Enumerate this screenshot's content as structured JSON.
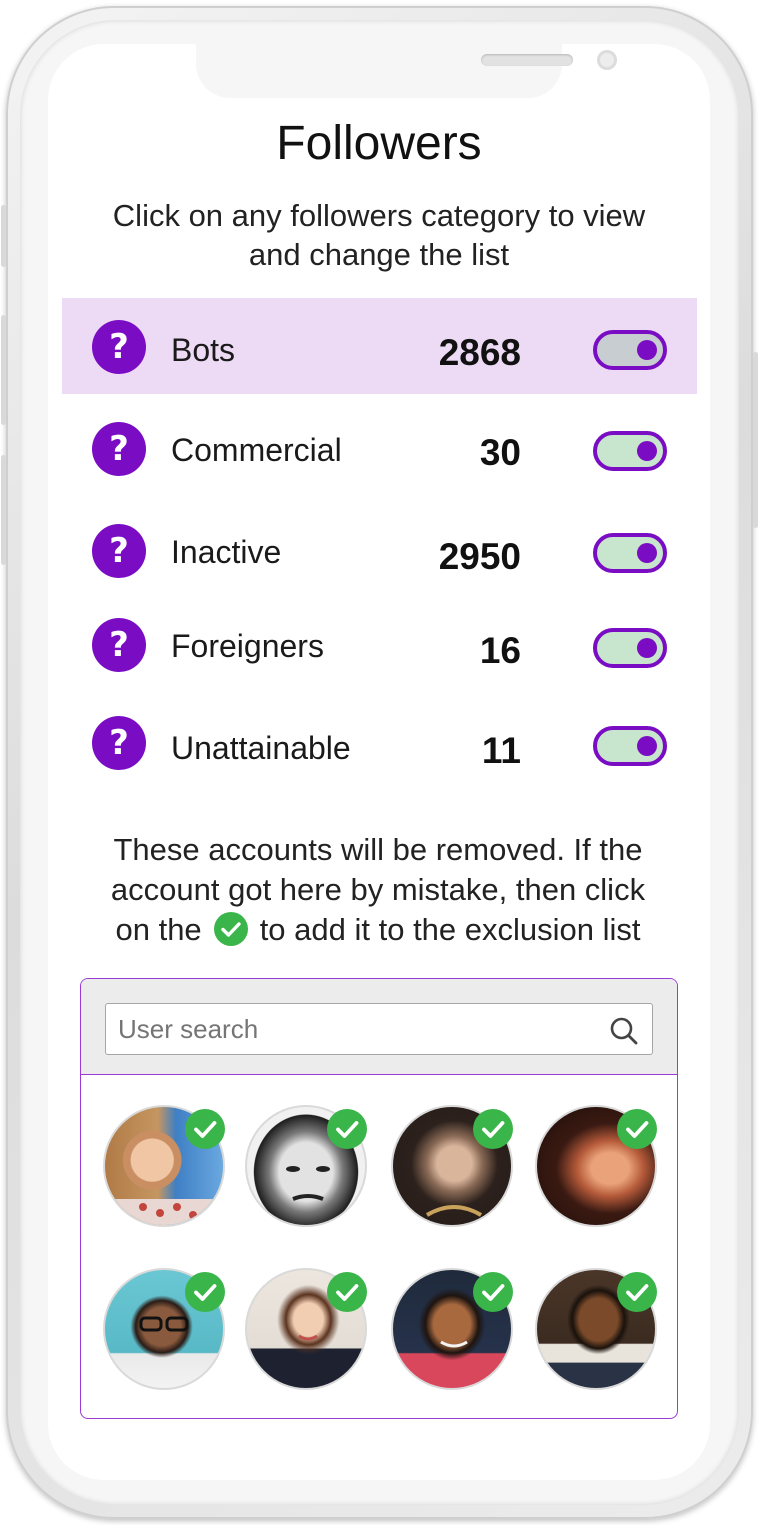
{
  "page": {
    "title": "Followers",
    "subtitle": "Click on any followers category to view and change the list"
  },
  "categories": [
    {
      "label": "Bots",
      "count": "2868",
      "selected": true,
      "toggle_on": true
    },
    {
      "label": "Commercial",
      "count": "30",
      "selected": false,
      "toggle_on": true
    },
    {
      "label": "Inactive",
      "count": "2950",
      "selected": false,
      "toggle_on": true
    },
    {
      "label": "Foreigners",
      "count": "16",
      "selected": false,
      "toggle_on": true
    },
    {
      "label": "Unattainable",
      "count": "11",
      "selected": false,
      "toggle_on": true
    }
  ],
  "notice": {
    "line1": "These accounts will be removed. If the",
    "line2": "account got here by mistake, then click",
    "line3_before": "on the",
    "line3_after": "to add it to the exclusion list"
  },
  "search": {
    "placeholder": "User search",
    "value": ""
  },
  "icons": {
    "category_help": "question-mark-icon",
    "search": "magnifier-icon",
    "exclude": "green-check-icon"
  },
  "colors": {
    "accent": "#7a0cc4",
    "selected_row": "#eddaf5",
    "toggle_track": "#c8e6cd",
    "check_green": "#3ab54a",
    "panel_border": "#9c3ad4"
  }
}
